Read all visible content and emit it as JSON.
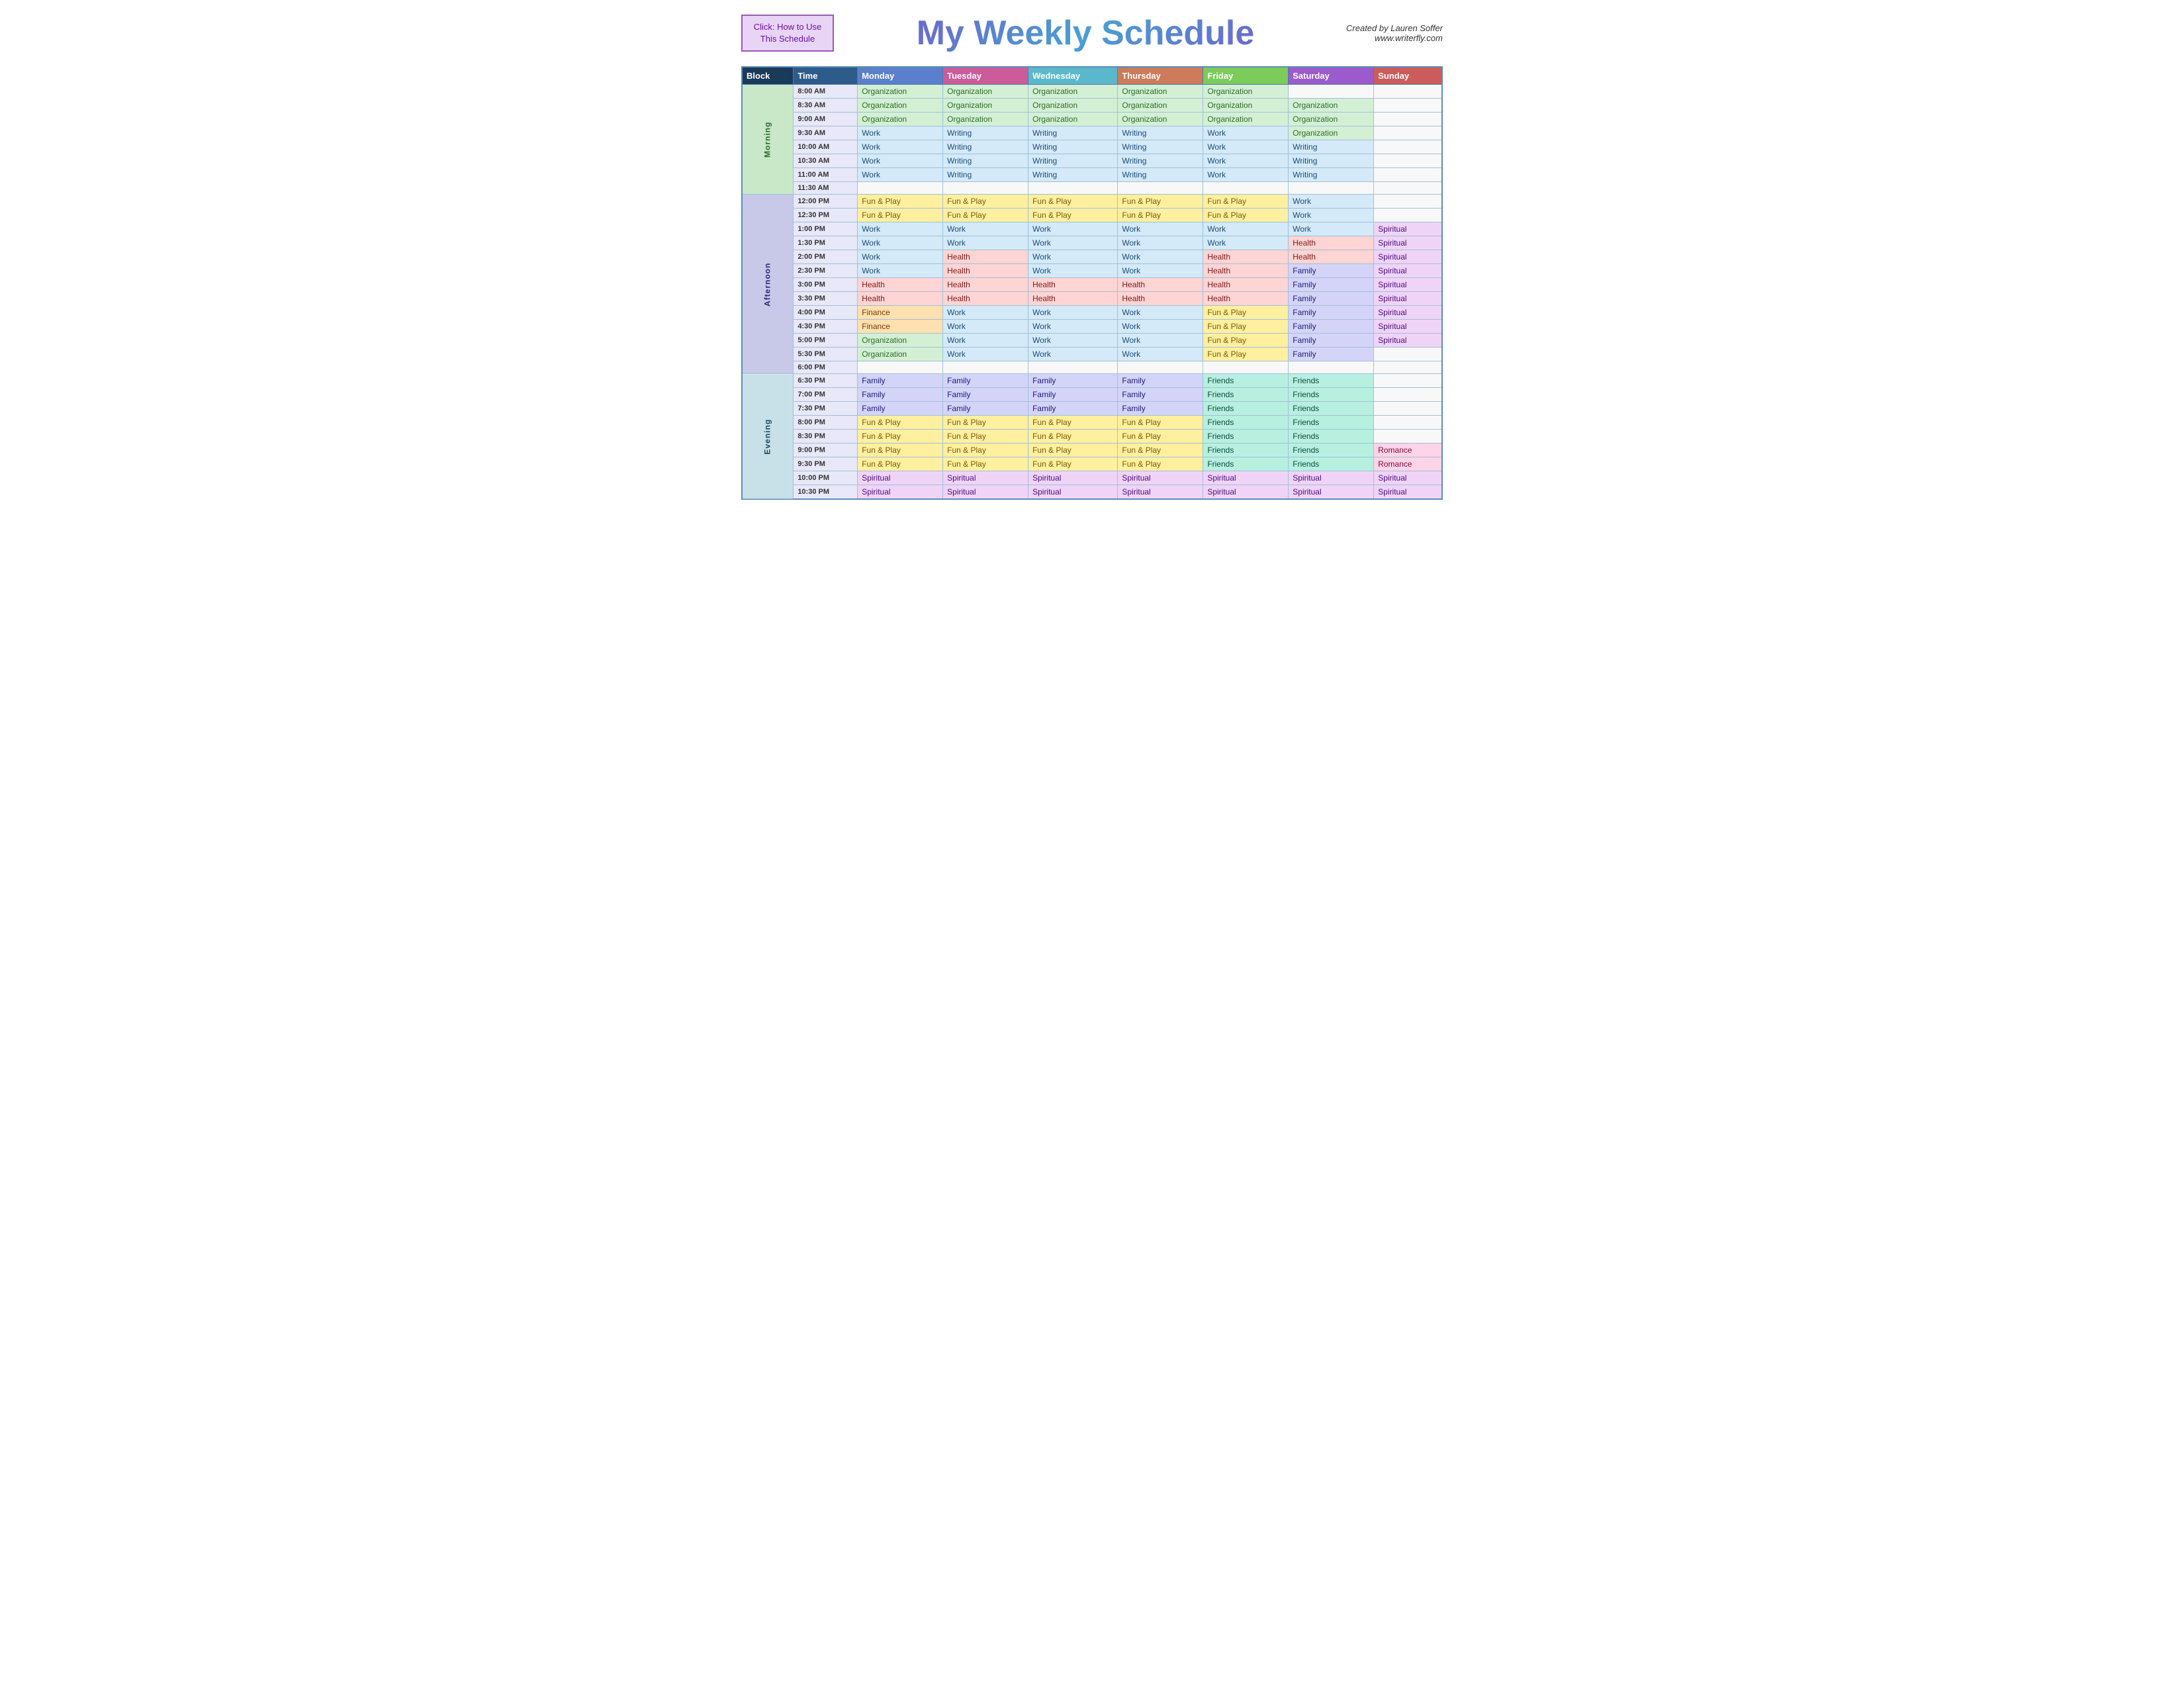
{
  "header": {
    "click_label": "Click:  How to Use This Schedule",
    "title": "My Weekly Schedule",
    "credit_line1": "Created by Lauren Soffer",
    "credit_line2": "www.writerfly.com"
  },
  "table": {
    "columns": [
      "Block",
      "Time",
      "Monday",
      "Tuesday",
      "Wednesday",
      "Thursday",
      "Friday",
      "Saturday",
      "Sunday"
    ],
    "rows": [
      {
        "block": "Morning",
        "time": "8:00 AM",
        "mon": "Organization",
        "tue": "Organization",
        "wed": "Organization",
        "thu": "Organization",
        "fri": "Organization",
        "sat": "",
        "sun": ""
      },
      {
        "block": "Morning",
        "time": "8:30 AM",
        "mon": "Organization",
        "tue": "Organization",
        "wed": "Organization",
        "thu": "Organization",
        "fri": "Organization",
        "sat": "Organization",
        "sun": ""
      },
      {
        "block": "Morning",
        "time": "9:00 AM",
        "mon": "Organization",
        "tue": "Organization",
        "wed": "Organization",
        "thu": "Organization",
        "fri": "Organization",
        "sat": "Organization",
        "sun": ""
      },
      {
        "block": "Morning",
        "time": "9:30 AM",
        "mon": "Work",
        "tue": "Writing",
        "wed": "Writing",
        "thu": "Writing",
        "fri": "Work",
        "sat": "Organization",
        "sun": ""
      },
      {
        "block": "Morning",
        "time": "10:00 AM",
        "mon": "Work",
        "tue": "Writing",
        "wed": "Writing",
        "thu": "Writing",
        "fri": "Work",
        "sat": "Writing",
        "sun": ""
      },
      {
        "block": "Morning",
        "time": "10:30 AM",
        "mon": "Work",
        "tue": "Writing",
        "wed": "Writing",
        "thu": "Writing",
        "fri": "Work",
        "sat": "Writing",
        "sun": ""
      },
      {
        "block": "Morning",
        "time": "11:00 AM",
        "mon": "Work",
        "tue": "Writing",
        "wed": "Writing",
        "thu": "Writing",
        "fri": "Work",
        "sat": "Writing",
        "sun": ""
      },
      {
        "block": "Morning",
        "time": "11:30 AM",
        "mon": "",
        "tue": "",
        "wed": "",
        "thu": "",
        "fri": "",
        "sat": "",
        "sun": ""
      },
      {
        "block": "Afternoon",
        "time": "12:00 PM",
        "mon": "Fun & Play",
        "tue": "Fun & Play",
        "wed": "Fun & Play",
        "thu": "Fun & Play",
        "fri": "Fun & Play",
        "sat": "Work",
        "sun": ""
      },
      {
        "block": "Afternoon",
        "time": "12:30 PM",
        "mon": "Fun & Play",
        "tue": "Fun & Play",
        "wed": "Fun & Play",
        "thu": "Fun & Play",
        "fri": "Fun & Play",
        "sat": "Work",
        "sun": ""
      },
      {
        "block": "Afternoon",
        "time": "1:00 PM",
        "mon": "Work",
        "tue": "Work",
        "wed": "Work",
        "thu": "Work",
        "fri": "Work",
        "sat": "Work",
        "sun": "Spiritual"
      },
      {
        "block": "Afternoon",
        "time": "1:30 PM",
        "mon": "Work",
        "tue": "Work",
        "wed": "Work",
        "thu": "Work",
        "fri": "Work",
        "sat": "Health",
        "sun": "Spiritual"
      },
      {
        "block": "Afternoon",
        "time": "2:00 PM",
        "mon": "Work",
        "tue": "Health",
        "wed": "Work",
        "thu": "Work",
        "fri": "Health",
        "sat": "Health",
        "sun": "Spiritual"
      },
      {
        "block": "Afternoon",
        "time": "2:30 PM",
        "mon": "Work",
        "tue": "Health",
        "wed": "Work",
        "thu": "Work",
        "fri": "Health",
        "sat": "Family",
        "sun": "Spiritual"
      },
      {
        "block": "Afternoon",
        "time": "3:00 PM",
        "mon": "Health",
        "tue": "Health",
        "wed": "Health",
        "thu": "Health",
        "fri": "Health",
        "sat": "Family",
        "sun": "Spiritual"
      },
      {
        "block": "Afternoon",
        "time": "3:30 PM",
        "mon": "Health",
        "tue": "Health",
        "wed": "Health",
        "thu": "Health",
        "fri": "Health",
        "sat": "Family",
        "sun": "Spiritual"
      },
      {
        "block": "Afternoon",
        "time": "4:00 PM",
        "mon": "Finance",
        "tue": "Work",
        "wed": "Work",
        "thu": "Work",
        "fri": "Fun & Play",
        "sat": "Family",
        "sun": "Spiritual"
      },
      {
        "block": "Afternoon",
        "time": "4:30 PM",
        "mon": "Finance",
        "tue": "Work",
        "wed": "Work",
        "thu": "Work",
        "fri": "Fun & Play",
        "sat": "Family",
        "sun": "Spiritual"
      },
      {
        "block": "Afternoon",
        "time": "5:00 PM",
        "mon": "Organization",
        "tue": "Work",
        "wed": "Work",
        "thu": "Work",
        "fri": "Fun & Play",
        "sat": "Family",
        "sun": "Spiritual"
      },
      {
        "block": "Afternoon",
        "time": "5:30 PM",
        "mon": "Organization",
        "tue": "Work",
        "wed": "Work",
        "thu": "Work",
        "fri": "Fun & Play",
        "sat": "Family",
        "sun": ""
      },
      {
        "block": "Afternoon",
        "time": "6:00 PM",
        "mon": "",
        "tue": "",
        "wed": "",
        "thu": "",
        "fri": "",
        "sat": "",
        "sun": ""
      },
      {
        "block": "Evening",
        "time": "6:30 PM",
        "mon": "Family",
        "tue": "Family",
        "wed": "Family",
        "thu": "Family",
        "fri": "Friends",
        "sat": "Friends",
        "sun": ""
      },
      {
        "block": "Evening",
        "time": "7:00 PM",
        "mon": "Family",
        "tue": "Family",
        "wed": "Family",
        "thu": "Family",
        "fri": "Friends",
        "sat": "Friends",
        "sun": ""
      },
      {
        "block": "Evening",
        "time": "7:30 PM",
        "mon": "Family",
        "tue": "Family",
        "wed": "Family",
        "thu": "Family",
        "fri": "Friends",
        "sat": "Friends",
        "sun": ""
      },
      {
        "block": "Evening",
        "time": "8:00 PM",
        "mon": "Fun & Play",
        "tue": "Fun & Play",
        "wed": "Fun & Play",
        "thu": "Fun & Play",
        "fri": "Friends",
        "sat": "Friends",
        "sun": ""
      },
      {
        "block": "Evening",
        "time": "8:30 PM",
        "mon": "Fun & Play",
        "tue": "Fun & Play",
        "wed": "Fun & Play",
        "thu": "Fun & Play",
        "fri": "Friends",
        "sat": "Friends",
        "sun": ""
      },
      {
        "block": "Evening",
        "time": "9:00 PM",
        "mon": "Fun & Play",
        "tue": "Fun & Play",
        "wed": "Fun & Play",
        "thu": "Fun & Play",
        "fri": "Friends",
        "sat": "Friends",
        "sun": "Romance"
      },
      {
        "block": "Evening",
        "time": "9:30 PM",
        "mon": "Fun & Play",
        "tue": "Fun & Play",
        "wed": "Fun & Play",
        "thu": "Fun & Play",
        "fri": "Friends",
        "sat": "Friends",
        "sun": "Romance"
      },
      {
        "block": "Evening",
        "time": "10:00 PM",
        "mon": "Spiritual",
        "tue": "Spiritual",
        "wed": "Spiritual",
        "thu": "Spiritual",
        "fri": "Spiritual",
        "sat": "Spiritual",
        "sun": "Spiritual"
      },
      {
        "block": "Evening",
        "time": "10:30 PM",
        "mon": "Spiritual",
        "tue": "Spiritual",
        "wed": "Spiritual",
        "thu": "Spiritual",
        "fri": "Spiritual",
        "sat": "Spiritual",
        "sun": "Spiritual"
      }
    ]
  }
}
